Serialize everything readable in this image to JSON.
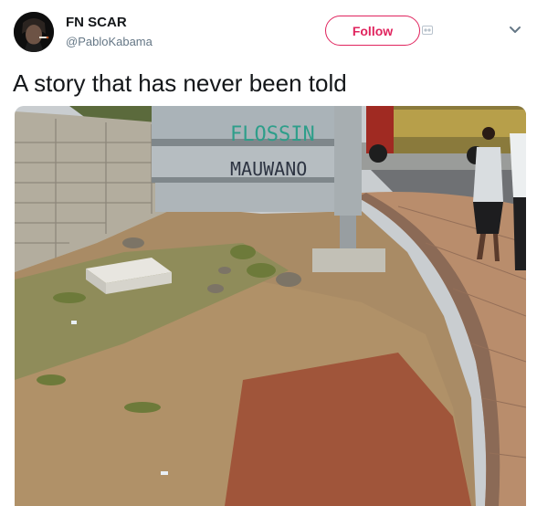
{
  "tweet": {
    "display_name": "FN SCAR",
    "handle": "@PabloKabama",
    "text": "A story that has never been told",
    "follow_label": "Follow"
  },
  "photo": {
    "sign_line1": "FLOSSIN",
    "sign_line2": "MAUWANO"
  },
  "colors": {
    "follow_accent": "#e0245e",
    "handle_gray": "#657786",
    "text": "#14171a"
  },
  "icons": [
    "avatar-image",
    "chevron-down-icon",
    "photo-badge-icon"
  ]
}
